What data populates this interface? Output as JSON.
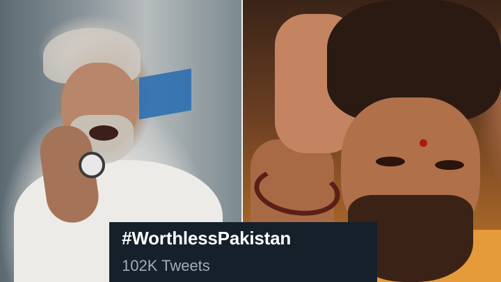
{
  "trend": {
    "hashtag": "#WorthlessPakistan",
    "tweet_count": "102K Tweets"
  },
  "colors": {
    "card_background": "#15202b",
    "hashtag_text": "#ffffff",
    "count_text": "#a2acb6"
  }
}
